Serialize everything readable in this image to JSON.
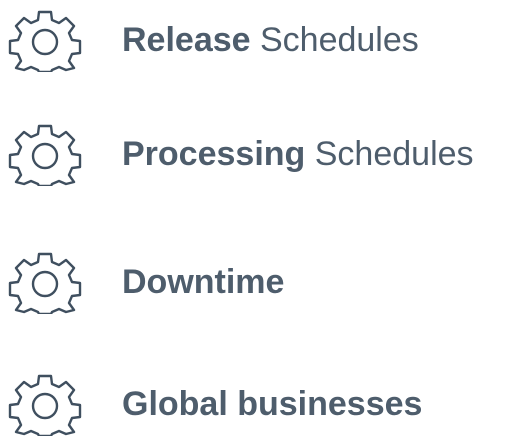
{
  "menu": {
    "items": [
      {
        "icon": "gear-icon",
        "bold": "Release",
        "regular": " Schedules"
      },
      {
        "icon": "gear-icon",
        "bold": "Processing",
        "regular": " Schedules"
      },
      {
        "icon": "gear-icon",
        "bold": "Downtime",
        "regular": ""
      },
      {
        "icon": "gear-icon",
        "bold": "Global businesses",
        "regular": ""
      }
    ]
  },
  "colors": {
    "text": "#4e5d6c",
    "icon_stroke": "#3f4f5f",
    "background": "#ffffff"
  }
}
